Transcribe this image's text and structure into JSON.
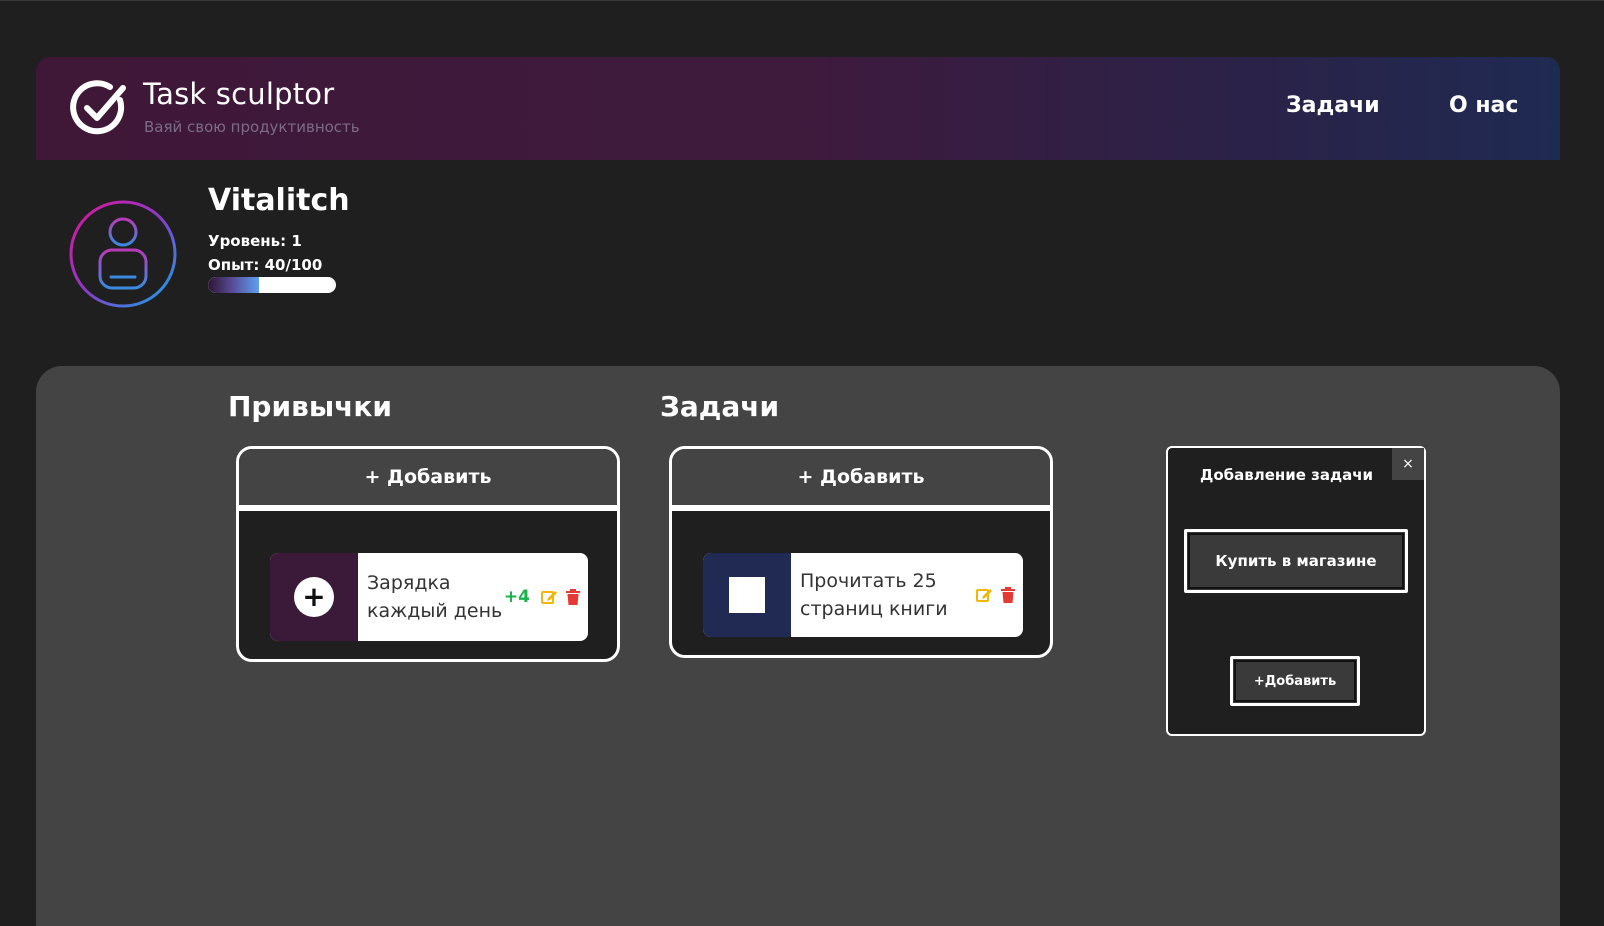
{
  "header": {
    "brand_title": "Task sculptor",
    "brand_subtitle": "Ваяй свою продуктивность",
    "nav": [
      {
        "label": "Задачи"
      },
      {
        "label": "О нас"
      }
    ]
  },
  "profile": {
    "username": "Vitalitch",
    "level_text": "Уровень: 1",
    "exp_text": "Опыт: 40/100",
    "exp_progress": 0.4
  },
  "habits": {
    "title": "Привычки",
    "add_label": "+ Добавить",
    "items": [
      {
        "text": "Зарядка каждый день",
        "points": "+4"
      }
    ]
  },
  "tasks": {
    "title": "Задачи",
    "add_label": "+ Добавить",
    "items": [
      {
        "text": "Прочитать 25 страниц книги"
      }
    ]
  },
  "dialog": {
    "title": "Добавление задачи",
    "close_label": "×",
    "input_value": "Купить в магазине",
    "add_label": "+Добавить"
  },
  "colors": {
    "accent_habit": "#3a1a38",
    "accent_task": "#202a52",
    "points_green": "#19b34b",
    "edit_yellow": "#f2b705",
    "delete_red": "#e53935"
  }
}
